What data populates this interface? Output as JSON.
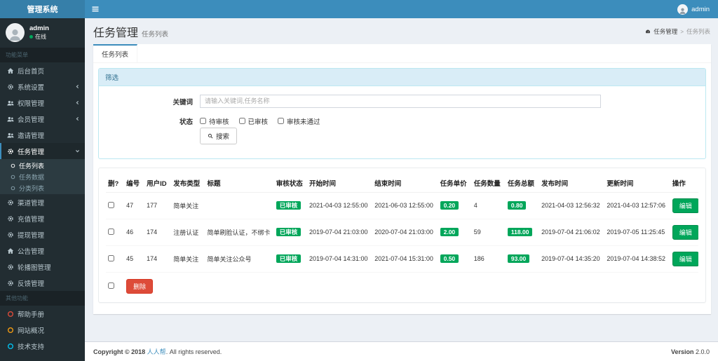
{
  "colors": {
    "navbar": "#3c8dbc",
    "logo_bg": "#367fa9",
    "sidebar_bg": "#222d32",
    "submenu_bg": "#2c3b41",
    "content_bg": "#ecf0f5",
    "success": "#00a65a",
    "danger": "#dd4b39",
    "filter_head_bg": "#d9edf7",
    "filter_border": "#bce8f1",
    "help_ring": "#dd4b39",
    "overview_ring": "#f39c12",
    "support_ring": "#00c0ef"
  },
  "icons": {
    "bars-icon": "hamburger menu (3 bars)",
    "user-icon": "person silhouette",
    "home-icon": "house",
    "gear-icon": "cog wheel",
    "users-icon": "two people",
    "circle-o-icon": "hollow ring bullet",
    "chevron-left-icon": "collapsed arrow",
    "chevron-down-icon": "expanded arrow",
    "dashboard-icon": "speedometer",
    "search-icon": "magnifier"
  },
  "navbar": {
    "brand": "管理系统",
    "user": "admin"
  },
  "sidebar": {
    "user_name": "admin",
    "user_status": "在线",
    "menu_label": "功能菜单",
    "other_label": "其他功能",
    "items": [
      {
        "label": "后台首页"
      },
      {
        "label": "系统设置"
      },
      {
        "label": "权限管理"
      },
      {
        "label": "会员管理"
      },
      {
        "label": "邀请管理"
      },
      {
        "label": "任务管理"
      },
      {
        "label": "渠道管理"
      },
      {
        "label": "充值管理"
      },
      {
        "label": "提现管理"
      },
      {
        "label": "公告管理"
      },
      {
        "label": "轮播图管理"
      },
      {
        "label": "反馈管理"
      }
    ],
    "subitems": [
      {
        "label": "任务列表"
      },
      {
        "label": "任务数据"
      },
      {
        "label": "分类列表"
      }
    ],
    "other_items": [
      {
        "label": "帮助手册"
      },
      {
        "label": "网站概况"
      },
      {
        "label": "技术支持"
      }
    ]
  },
  "header": {
    "title": "任务管理",
    "subtitle": "任务列表",
    "breadcrumb": [
      "任务管理",
      "任务列表"
    ],
    "breadcrumb_sep": ">"
  },
  "tabs": [
    {
      "label": "任务列表"
    }
  ],
  "filter": {
    "panel_title": "筛选",
    "keyword_label": "关键词",
    "keyword_placeholder": "请输入关键词,任务名称",
    "keyword_value": "",
    "status_label": "状态",
    "status_options": [
      "待审核",
      "已审核",
      "审核未通过"
    ],
    "search_label": "搜索"
  },
  "table": {
    "columns": [
      "删?",
      "编号",
      "用户ID",
      "发布类型",
      "标题",
      "审核状态",
      "开始时间",
      "结束时间",
      "任务单价",
      "任务数量",
      "任务总额",
      "发布时间",
      "更新时间",
      "操作"
    ],
    "rows": [
      {
        "id": "47",
        "user_id": "177",
        "type": "简单关注",
        "title": "",
        "status": "已审核",
        "start": "2021-04-03 12:55:00",
        "end": "2021-06-03 12:55:00",
        "price": "0.20",
        "count": "4",
        "total": "0.80",
        "publish": "2021-04-03 12:56:32",
        "update": "2021-04-03 12:57:06",
        "action": "编辑"
      },
      {
        "id": "46",
        "user_id": "174",
        "type": "注册认证",
        "title": "简单刷脸认证，不绑卡",
        "status": "已审核",
        "start": "2019-07-04 21:03:00",
        "end": "2020-07-04 21:03:00",
        "price": "2.00",
        "count": "59",
        "total": "118.00",
        "publish": "2019-07-04 21:06:02",
        "update": "2019-07-05 11:25:45",
        "action": "编辑"
      },
      {
        "id": "45",
        "user_id": "174",
        "type": "简单关注",
        "title": "简单关注公众号",
        "status": "已审核",
        "start": "2019-07-04 14:31:00",
        "end": "2021-07-04 15:31:00",
        "price": "0.50",
        "count": "186",
        "total": "93.00",
        "publish": "2019-07-04 14:35:20",
        "update": "2019-07-04 14:38:52",
        "action": "编辑"
      }
    ],
    "delete_label": "删除"
  },
  "footer": {
    "copyright": "Copyright © 2018",
    "brand": "人人帮",
    "rights": ". All rights reserved.",
    "version_label": "Version",
    "version_value": "2.0.0"
  }
}
